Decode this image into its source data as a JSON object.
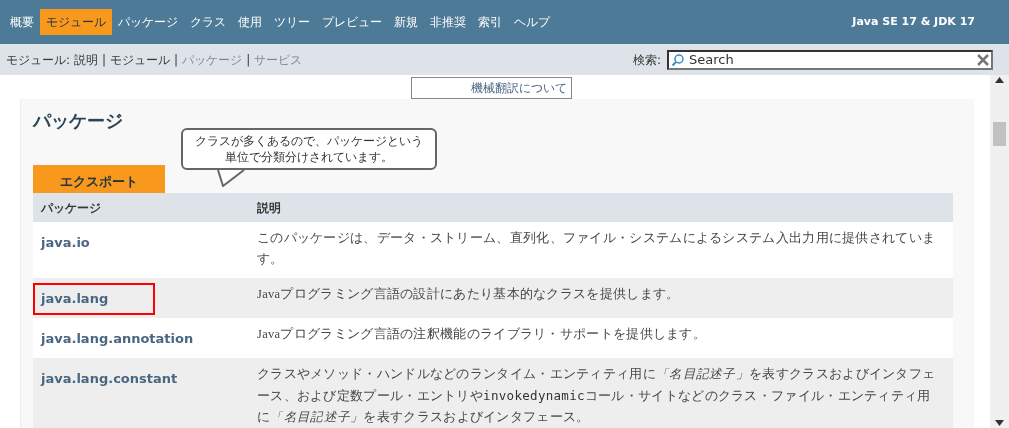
{
  "top_nav": {
    "items": [
      {
        "label": "概要",
        "selected": false
      },
      {
        "label": "モジュール",
        "selected": true
      },
      {
        "label": "パッケージ",
        "selected": false
      },
      {
        "label": "クラス",
        "selected": false
      },
      {
        "label": "使用",
        "selected": false
      },
      {
        "label": "ツリー",
        "selected": false
      },
      {
        "label": "プレビュー",
        "selected": false
      },
      {
        "label": "新規",
        "selected": false
      },
      {
        "label": "非推奨",
        "selected": false
      },
      {
        "label": "索引",
        "selected": false
      },
      {
        "label": "ヘルプ",
        "selected": false
      }
    ],
    "product": "Java SE 17 & JDK 17"
  },
  "sub_nav": {
    "prefix": "モジュール:",
    "links": [
      {
        "label": "説明",
        "disabled": false
      },
      {
        "label": "モジュール",
        "disabled": false
      },
      {
        "label": "パッケージ",
        "disabled": true
      },
      {
        "label": "サービス",
        "disabled": true
      }
    ],
    "separator": "|"
  },
  "search": {
    "label": "検索:",
    "placeholder": "Search"
  },
  "translation_button": "機械翻訳について",
  "section_title": "パッケージ",
  "callout": "クラスが多くあるので、パッケージという単位で分類分けされています。",
  "tab": "エクスポート",
  "table": {
    "columns": [
      "パッケージ",
      "説明"
    ],
    "rows": [
      {
        "package": "java.io",
        "highlighted": false,
        "description": [
          {
            "kind": "text",
            "text": "このパッケージは、データ・ストリーム、直列化、ファイル・システムによるシステム入出力用に提供されています。"
          }
        ]
      },
      {
        "package": "java.lang",
        "highlighted": true,
        "description": [
          {
            "kind": "text",
            "text": "Javaプログラミング言語の設計にあたり基本的なクラスを提供します。"
          }
        ]
      },
      {
        "package": "java.lang.annotation",
        "highlighted": false,
        "description": [
          {
            "kind": "text",
            "text": "Javaプログラミング言語の注釈機能のライブラリ・サポートを提供します。"
          }
        ]
      },
      {
        "package": "java.lang.constant",
        "highlighted": false,
        "description": [
          {
            "kind": "text",
            "text": "クラスやメソッド・ハンドルなどのランタイム・エンティティ用に"
          },
          {
            "kind": "italic",
            "text": "「名目記述子」"
          },
          {
            "kind": "text",
            "text": "を表すクラスおよびインタフェース、および定数プール・エントリや"
          },
          {
            "kind": "code",
            "text": "invokedynamic"
          },
          {
            "kind": "text",
            "text": "コール・サイトなどのクラス・ファイル・エンティティ用に"
          },
          {
            "kind": "italic",
            "text": "「名目記述子」"
          },
          {
            "kind": "text",
            "text": "を表すクラスおよびインタフェース。"
          }
        ]
      }
    ]
  }
}
